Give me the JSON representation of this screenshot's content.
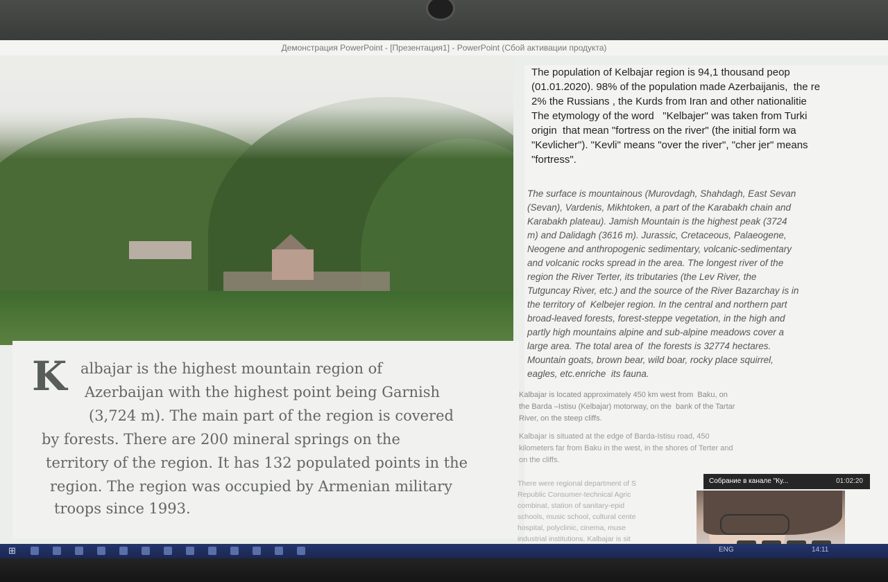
{
  "window": {
    "title": "Демонстрация PowerPoint - [Презентация1] - PowerPoint (Сбой активации продукта)"
  },
  "slide": {
    "dropcap": "K",
    "lead_lines": [
      "albajar is the highest mountain region of",
      "Azerbaijan with the highest point being Garnish",
      "(3,724 m). The main part of the region is covered",
      "by forests. There are 200 mineral springs on the",
      "territory of the region. It has 132 populated points in the",
      "region. The region was occupied by Armenian military",
      "troops since 1993."
    ],
    "para1": "The population of Kelbajar region is 94,1 thousand peop\n(01.01.2020). 98% of the population made Azerbaijanis,  the re\n2% the Russians , the Kurds from Iran and other nationalitie\nThe etymology of the word   \"Kelbajer\" was taken from Turki\norigin  that mean \"fortress on the river\" (the initial form wa\n\"Kevlicher\"). \"Kevli\" means \"over the river\", \"cher jer\" means\n\"fortress\".",
    "para2": "The surface is mountainous (Murovdagh, Shahdagh, East Sevan\n(Sevan), Vardenis, Mikhtoken, a part of the Karabakh chain and\nKarabakh plateau). Jamish Mountain is the highest peak (3724\nm) and Dalidagh (3616 m). Jurassic, Cretaceous, Palaeogene,\nNeogene and anthropogenic sedimentary, volcanic-sedimentary\nand volcanic rocks spread in the area. The longest river of the\nregion the River Terter, its tributaries (the Lev River, the\nTutguncay River, etc.) and the source of the River Bazarchay is in\nthe territory of  Kelbejer region. In the central and northern part\nbroad-leaved forests, forest-steppe vegetation, in the high and\npartly high mountains alpine and sub-alpine meadows cover a\nlarge area. The total area of  the forests is 32774 hectares.\nMountain goats, brown bear, wild boar, rocky place squirrel,\neagles, etc.enriche  its fauna.",
    "para3": "Kalbajar is located approximately 450 km west from  Baku, on\nthe Barda –Istisu (Kelbajar) motorway, on the  bank of the Tartar\nRiver, on the steep cliffs.",
    "para4": "Kalbajar is situated at the edge of Barda-Istisu road, 450\nkilometers far from Baku in the west, in the shores of Terter and\non the cliffs.",
    "para5": "There were regional department of S\nRepublic Consumer-technical Agric\ncombinat, station of sanitary-epid\nschools, music school, cultural cente\nhospital, polyclinic, cinema, muse\nindustrial institutions. Kalbajar is sit"
  },
  "call": {
    "title": "Собрание в канале \"Ку...",
    "time": "01:02:20",
    "controls": [
      "camera-icon",
      "microphone-icon",
      "share-screen-icon",
      "hang-up-icon"
    ]
  },
  "taskbar": {
    "lang": "ENG",
    "clock": "14:11"
  },
  "colors": {
    "taskbar": "#1b2753",
    "slide_bg": "#eceeeb",
    "call_bar": "#262626"
  }
}
